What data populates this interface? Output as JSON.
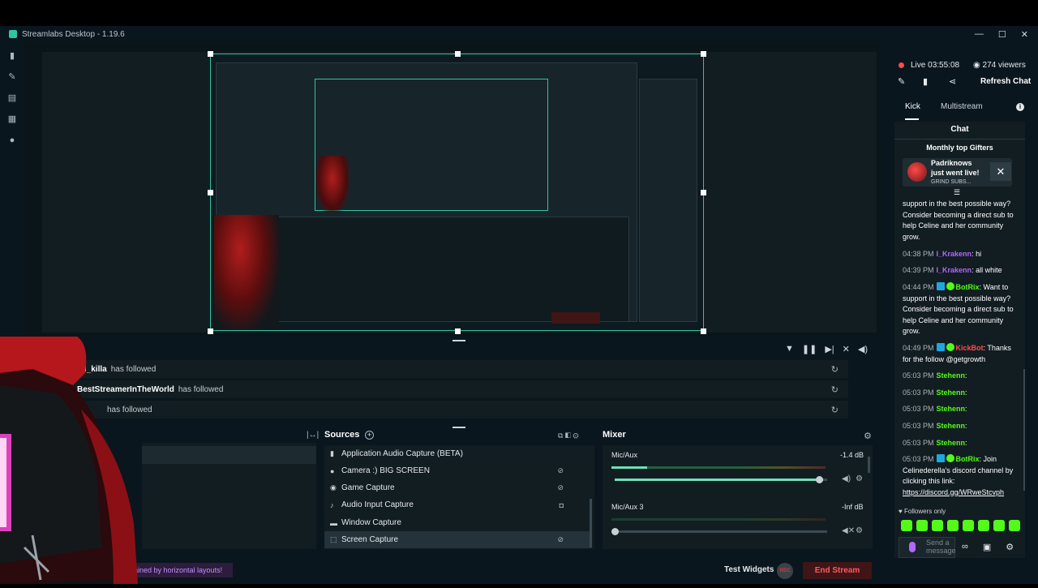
{
  "window": {
    "title": "Streamlabs Desktop - 1.19.6",
    "minimize": "—",
    "maximize": "☐",
    "close": "✕"
  },
  "left_nav": {
    "icons": [
      "editor-icon",
      "themes-icon",
      "store-icon",
      "layout-icon",
      "play-icon"
    ]
  },
  "events": {
    "rows": [
      {
        "user": "ad_killa",
        "action": "has followed"
      },
      {
        "user": "BestStreamerInTheWorld",
        "action": "has followed"
      },
      {
        "user": "",
        "action": "has followed"
      }
    ]
  },
  "sources": {
    "title": "Sources",
    "items": [
      {
        "label": "Application Audio Capture (BETA)",
        "icon": "app-audio-icon",
        "selected": false
      },
      {
        "label": "Camera :) BIG SCREEN",
        "icon": "camera-icon",
        "selected": false
      },
      {
        "label": "Game Capture",
        "icon": "gamepad-icon",
        "selected": false
      },
      {
        "label": "Audio Input Capture",
        "icon": "microphone-icon",
        "selected": false
      },
      {
        "label": "Window Capture",
        "icon": "window-icon",
        "selected": false
      },
      {
        "label": "Screen Capture",
        "icon": "screen-icon",
        "selected": true
      }
    ]
  },
  "mixer": {
    "title": "Mixer",
    "channels": [
      {
        "name": "Mic/Aux",
        "db": "-1.4 dB",
        "volume": 0.98
      },
      {
        "name": "Mic/Aux 3",
        "db": "-Inf dB",
        "volume": 0.0
      }
    ]
  },
  "footer": {
    "banner": "ained by horizontal layouts!",
    "test_widgets": "Test Widgets",
    "rec": "REC",
    "end_stream": "End Stream"
  },
  "stream": {
    "live_label": "Live",
    "duration": "03:55:08",
    "viewers": "274 viewers",
    "refresh_chat": "Refresh Chat"
  },
  "chat_tabs": {
    "kick": "Kick",
    "multistream": "Multistream"
  },
  "chat": {
    "title": "Chat",
    "gifters_title": "Monthly top Gifters",
    "alert": {
      "name": "Padriknows",
      "message": "just went live!",
      "sub": "GRIND SUBS..."
    },
    "messages": [
      {
        "time": "",
        "user": "",
        "text": "support in the best possible way? Consider becoming a direct sub to help Celine and her community grow."
      },
      {
        "time": "04:38 PM",
        "user": "I_Krakenn",
        "text": ": hi"
      },
      {
        "time": "04:39 PM",
        "user": "I_Krakenn",
        "text": ": all white"
      },
      {
        "time": "04:44 PM",
        "user": "BotRix",
        "text": ": Want to support in the best possible way? Consider becoming a direct sub to help Celine and her community grow."
      },
      {
        "time": "04:49 PM",
        "user": "KickBot",
        "text": ": Thanks for the follow @getgrowth"
      },
      {
        "time": "05:03 PM",
        "user": "Stehenn",
        "text": ":"
      },
      {
        "time": "05:03 PM",
        "user": "Stehenn",
        "text": ":"
      },
      {
        "time": "05:03 PM",
        "user": "Stehenn",
        "text": ":"
      },
      {
        "time": "05:03 PM",
        "user": "Stehenn",
        "text": ":"
      },
      {
        "time": "05:03 PM",
        "user": "Stehenn",
        "text": ":"
      },
      {
        "time": "05:03 PM",
        "user": "BotRix",
        "text": ": Join Celinederella's discord channel by clicking this link:",
        "link": "https://discord.gg/WRweStcvph"
      }
    ],
    "followers_only": "Followers only",
    "input_placeholder": "Send a message"
  },
  "colors": {
    "accent": "#31c3a2",
    "kick_green": "#53fc18",
    "end_stream_red": "#ff5a5f",
    "background": "#09161d"
  }
}
